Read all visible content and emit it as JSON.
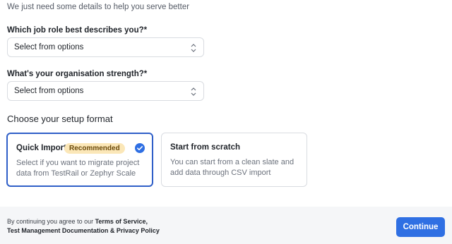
{
  "intro": "We just need some details to help you serve better",
  "job_role": {
    "label": "Which job role best describes you?*",
    "value": "Select from options"
  },
  "org_strength": {
    "label": "What's your organisation strength?*",
    "value": "Select from options"
  },
  "setup": {
    "title": "Choose your setup format",
    "options": [
      {
        "title": "Quick Import",
        "badge": "Recommended",
        "description": "Select if you want to migrate project data from TestRail or Zephyr Scale",
        "selected": true
      },
      {
        "title": "Start from scratch",
        "description": "You can start from a clean slate and add data through CSV import",
        "selected": false
      }
    ]
  },
  "footer": {
    "legal_prefix": "By continuing you agree to our ",
    "terms_link": "Terms of Service,",
    "docs_link": "Test Management Documentation & Privacy Policy",
    "continue_label": "Continue"
  },
  "colors": {
    "accent": "#2f6fe3",
    "selected_border": "#2f5fc8",
    "badge_bg": "#fbe7b8",
    "footer_bg": "#f5f6f8"
  },
  "icons": {
    "select_chevron": "chevron-up-down-icon",
    "selected_marker": "check-circle-icon"
  }
}
